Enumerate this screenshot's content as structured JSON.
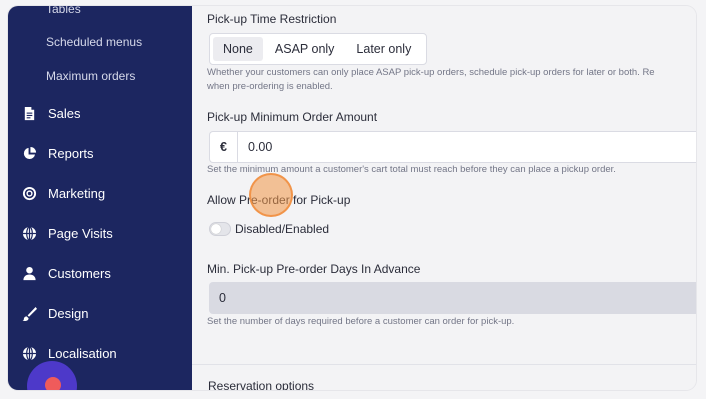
{
  "sidebar": {
    "sub_items": [
      {
        "label": "Tables"
      },
      {
        "label": "Scheduled menus"
      },
      {
        "label": "Maximum orders"
      }
    ],
    "nav_items": [
      {
        "label": "Sales",
        "icon": "document-icon"
      },
      {
        "label": "Reports",
        "icon": "pie-chart-icon"
      },
      {
        "label": "Marketing",
        "icon": "target-icon"
      },
      {
        "label": "Page Visits",
        "icon": "globe-icon"
      },
      {
        "label": "Customers",
        "icon": "user-icon"
      },
      {
        "label": "Design",
        "icon": "brush-icon"
      },
      {
        "label": "Localisation",
        "icon": "globe-icon"
      }
    ]
  },
  "main": {
    "time_restriction": {
      "label": "Pick-up Time Restriction",
      "options": [
        "None",
        "ASAP only",
        "Later only"
      ],
      "selected": "None",
      "help_line1": "Whether your customers can only place ASAP pick-up orders, schedule pick-up orders for later or both. Re",
      "help_line2": "when pre-ordering is enabled."
    },
    "min_order": {
      "label": "Pick-up Minimum Order Amount",
      "prefix": "€",
      "value": "0.00",
      "help": "Set the minimum amount a customer's cart total must reach before they can place a pickup order."
    },
    "preorder": {
      "label": "Allow Pre-order for Pick-up",
      "toggle_label": "Disabled/Enabled"
    },
    "preorder_days": {
      "label": "Min. Pick-up Pre-order Days In Advance",
      "value": "0",
      "help": "Set the number of days required before a customer can order for pick-up."
    },
    "section_title": "Reservation options"
  },
  "colors": {
    "sidebar_bg": "#1c2660",
    "avatar_bg": "#4d39c9",
    "click_indicator": "#f0963f"
  }
}
